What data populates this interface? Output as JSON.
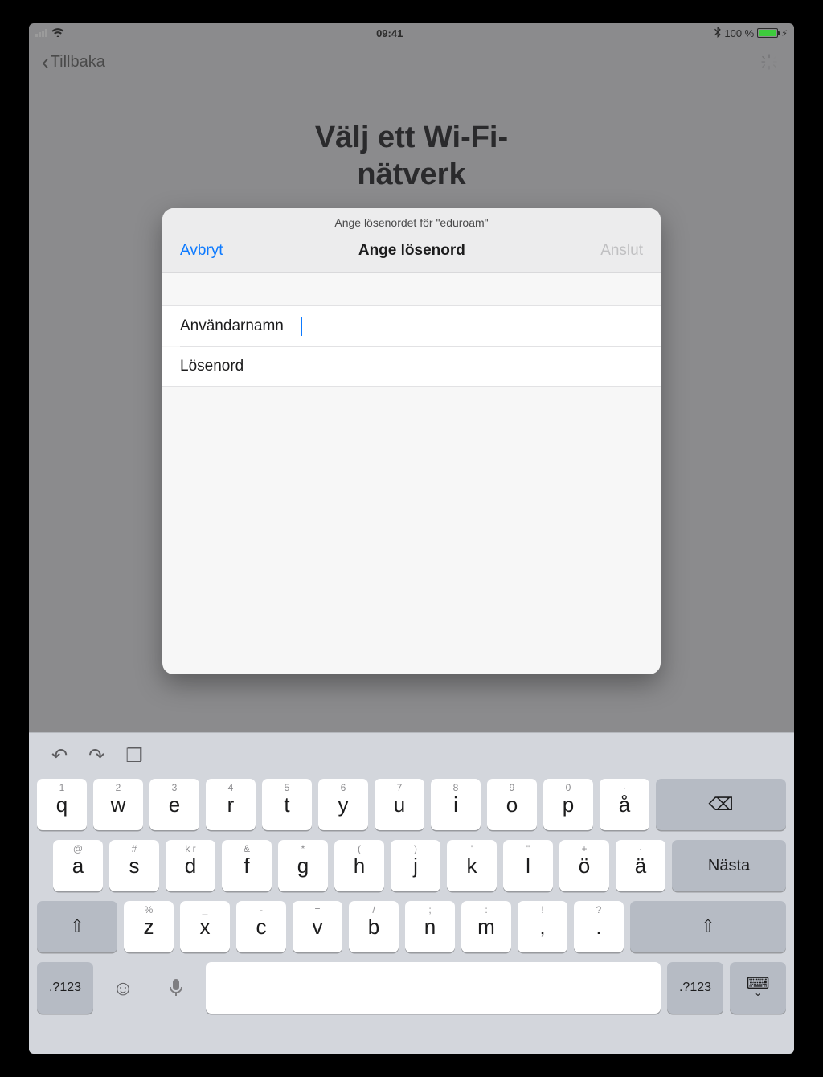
{
  "status": {
    "time": "09:41",
    "battery_pct": "100 %"
  },
  "nav": {
    "back_label": "Tillbaka"
  },
  "page": {
    "title": "Välj ett Wi-Fi-\nnätverk"
  },
  "modal": {
    "prompt": "Ange lösenordet för \"eduroam\"",
    "cancel": "Avbryt",
    "title": "Ange lösenord",
    "connect": "Anslut",
    "fields": {
      "username_label": "Användarnamn",
      "username_value": "",
      "password_label": "Lösenord",
      "password_value": ""
    }
  },
  "keyboard": {
    "row1": [
      {
        "main": "q",
        "hint": "1"
      },
      {
        "main": "w",
        "hint": "2"
      },
      {
        "main": "e",
        "hint": "3"
      },
      {
        "main": "r",
        "hint": "4"
      },
      {
        "main": "t",
        "hint": "5"
      },
      {
        "main": "y",
        "hint": "6"
      },
      {
        "main": "u",
        "hint": "7"
      },
      {
        "main": "i",
        "hint": "8"
      },
      {
        "main": "o",
        "hint": "9"
      },
      {
        "main": "p",
        "hint": "0"
      },
      {
        "main": "å",
        "hint": "·"
      }
    ],
    "row2": [
      {
        "main": "a",
        "hint": "@"
      },
      {
        "main": "s",
        "hint": "#"
      },
      {
        "main": "d",
        "hint": "k r"
      },
      {
        "main": "f",
        "hint": "&"
      },
      {
        "main": "g",
        "hint": "*"
      },
      {
        "main": "h",
        "hint": "("
      },
      {
        "main": "j",
        "hint": ")"
      },
      {
        "main": "k",
        "hint": "'"
      },
      {
        "main": "l",
        "hint": "\""
      },
      {
        "main": "ö",
        "hint": "+"
      },
      {
        "main": "ä",
        "hint": "·"
      }
    ],
    "row2_action": "Nästa",
    "row3": [
      {
        "main": "z",
        "hint": "%"
      },
      {
        "main": "x",
        "hint": "_"
      },
      {
        "main": "c",
        "hint": "-"
      },
      {
        "main": "v",
        "hint": "="
      },
      {
        "main": "b",
        "hint": "/"
      },
      {
        "main": "n",
        "hint": ";"
      },
      {
        "main": "m",
        "hint": ":"
      },
      {
        "main": ",",
        "hint": "!"
      },
      {
        "main": ".",
        "hint": "?"
      }
    ],
    "row4_nums": ".?123"
  }
}
